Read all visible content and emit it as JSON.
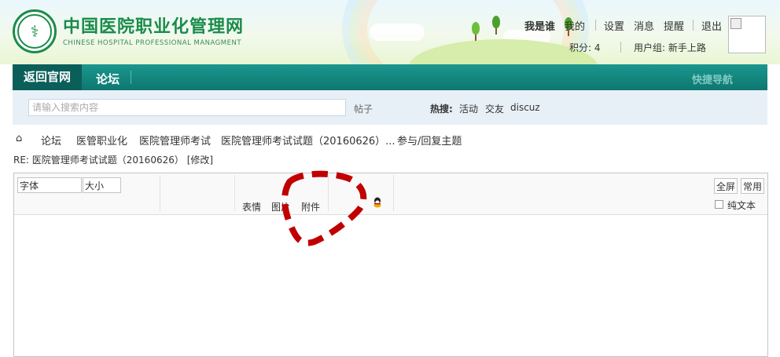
{
  "header": {
    "site_title": "中国医院职业化管理网",
    "site_subtitle": "CHINESE HOSPITAL PROFESSIONAL MANAGMENT",
    "user_name": "我是谁",
    "links": {
      "mine": "我的",
      "settings": "设置",
      "messages": "消息",
      "remind": "提醒",
      "logout": "退出"
    },
    "points": "积分: 4",
    "user_group": "用户组: 新手上路"
  },
  "nav": {
    "back": "返回官网",
    "forum": "论坛",
    "quick_nav": "快捷导航"
  },
  "search": {
    "placeholder": "请输入搜索内容",
    "type": "帖子",
    "hot_label": "热搜:",
    "hot_terms": [
      "活动",
      "交友",
      "discuz"
    ]
  },
  "breadcrumb": [
    "论坛",
    "医管职业化",
    "医院管理师考试",
    "医院管理师考试试题（20160626）...",
    "参与/回复主题"
  ],
  "reply": {
    "title": "RE: 医院管理师考试试题（20160626）",
    "edit_link": "[修改]"
  },
  "editor": {
    "font_label": "字体",
    "size_label": "大小",
    "emoji": "表情",
    "image": "图片",
    "attachment": "附件",
    "fullscreen": "全屏",
    "common": "常用",
    "plain_text": "纯文本"
  },
  "colors": {
    "brand_green": "#1a8c4a",
    "nav_teal": "#0d7770",
    "annotation_red": "#c00000"
  }
}
